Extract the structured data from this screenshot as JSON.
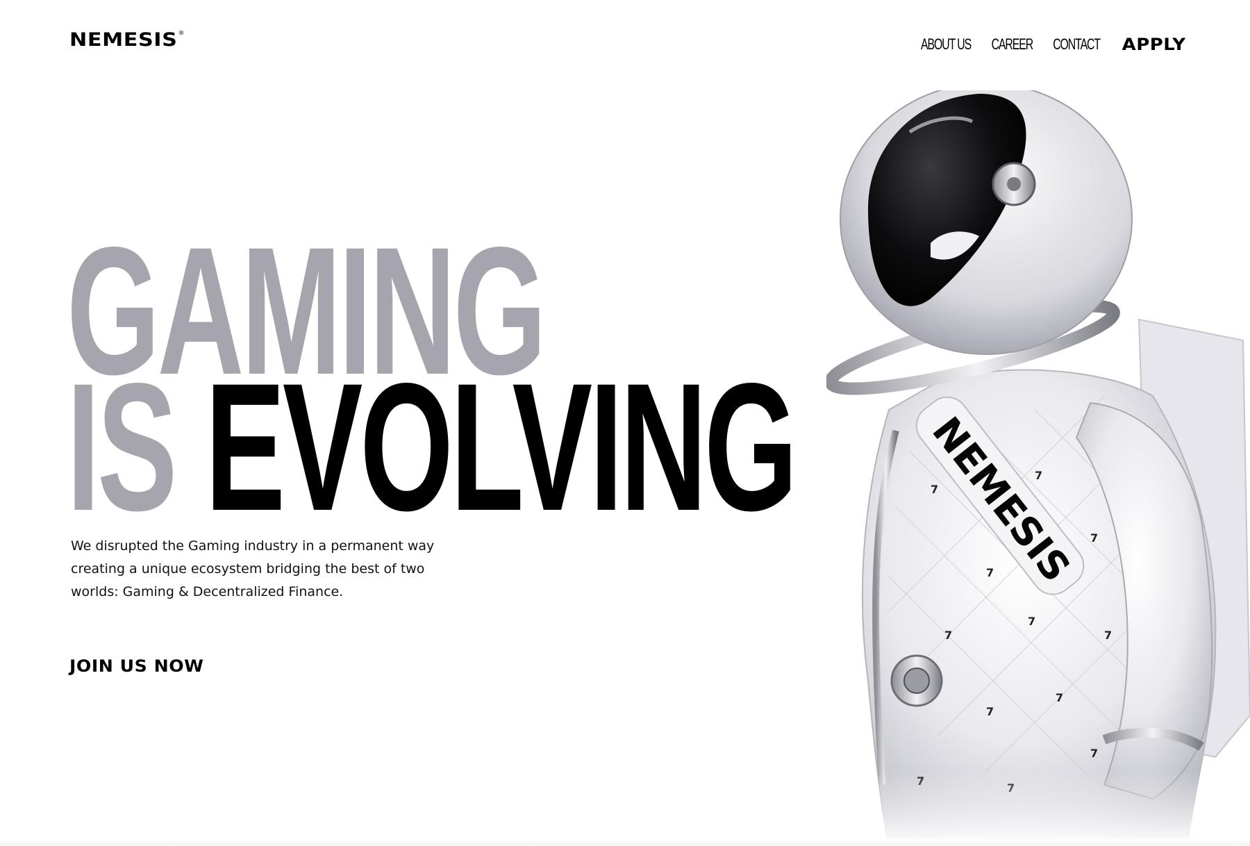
{
  "brand": {
    "name": "NEMESIS",
    "mark": "®"
  },
  "nav": {
    "items": [
      {
        "label": "ABOUT US"
      },
      {
        "label": "CAREER"
      },
      {
        "label": "CONTACT"
      }
    ],
    "apply_label": "APPLY"
  },
  "hero": {
    "line1_gray": "GAMING",
    "line2_gray": "IS",
    "line2_black": "EVOLVING",
    "description": "We disrupted the Gaming industry in a permanent way creating a unique ecosystem bridging the best of two worlds: Gaming & Decentralized Finance.",
    "cta_label": "JOIN US NOW"
  },
  "illustration": {
    "subject": "astronaut-in-white-spacesuit",
    "sash_text": "NEMESIS",
    "badge_text": "7"
  },
  "colors": {
    "background": "#ffffff",
    "text": "#000000",
    "headline_gray": "#a6a5ae"
  }
}
